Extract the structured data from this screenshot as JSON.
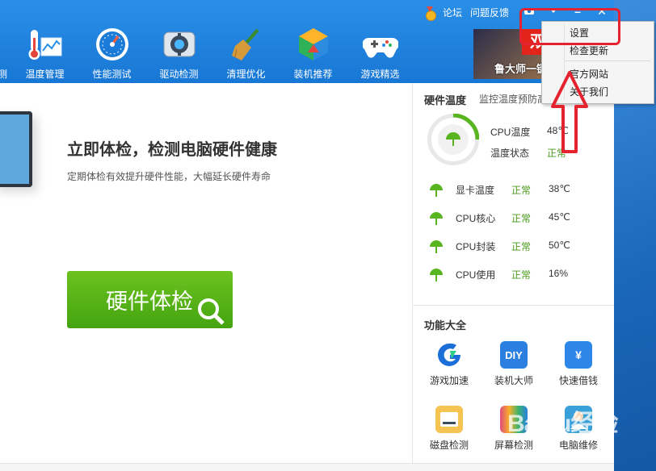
{
  "titlebar": {
    "links": [
      "论坛",
      "问题反馈"
    ],
    "controls": [
      "⬤",
      "▾",
      "–",
      "✕"
    ]
  },
  "tabs": [
    {
      "label": "测",
      "icon": "partial-icon"
    },
    {
      "label": "温度管理",
      "icon": "thermometer-icon"
    },
    {
      "label": "性能测试",
      "icon": "speedometer-icon"
    },
    {
      "label": "驱动检测",
      "icon": "gear-chip-icon"
    },
    {
      "label": "清理优化",
      "icon": "broom-icon"
    },
    {
      "label": "装机推荐",
      "icon": "cube-icon"
    },
    {
      "label": "游戏精选",
      "icon": "gamepad-icon"
    }
  ],
  "banner": {
    "badge": "双",
    "text": "鲁大师一键"
  },
  "main": {
    "headline": "立即体检，检测电脑硬件健康",
    "subline": "定期体检有效提升硬件性能，大幅延长硬件寿命",
    "check_button": "硬件体检"
  },
  "hardware_temp": {
    "title": "硬件温度",
    "subtitle": "监控温度预防高",
    "cpu_temp_label": "CPU温度",
    "cpu_temp_value": "48℃",
    "status_label": "温度状态",
    "status_value": "正常",
    "rows": [
      {
        "label": "显卡温度",
        "status": "正常",
        "value": "38℃"
      },
      {
        "label": "CPU核心",
        "status": "正常",
        "value": "45℃"
      },
      {
        "label": "CPU封装",
        "status": "正常",
        "value": "50℃"
      },
      {
        "label": "CPU使用",
        "status": "正常",
        "value": "16%"
      }
    ]
  },
  "functions": {
    "title": "功能大全",
    "items": [
      {
        "label": "游戏加速",
        "icon": "game-boost-icon",
        "color": "#1d6fd8"
      },
      {
        "label": "装机大师",
        "icon": "diy-icon",
        "color": "#2a7fe0"
      },
      {
        "label": "快速借钱",
        "icon": "money-icon",
        "color": "#2e86e8"
      },
      {
        "label": "磁盘检测",
        "icon": "disk-icon",
        "color": "#f0a030"
      },
      {
        "label": "屏幕检测",
        "icon": "screen-icon",
        "color": "#e04b7a"
      },
      {
        "label": "电脑维修",
        "icon": "repair-icon",
        "color": "#3aa0d8"
      }
    ]
  },
  "menu": {
    "items": [
      "设置",
      "检查更新",
      "官方网站",
      "关于我们"
    ]
  },
  "watermark": "Baidu经验",
  "colors": {
    "accent": "#1877d5",
    "ok": "#4a9a1c",
    "highlight": "#e5232f",
    "button": "#56b318"
  }
}
